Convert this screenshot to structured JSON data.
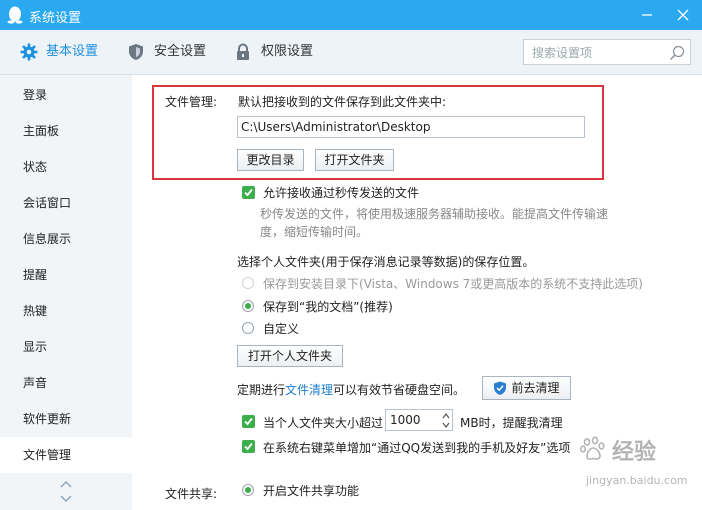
{
  "window": {
    "title": "系统设置"
  },
  "toolbar": {
    "tabs": [
      {
        "label": "基本设置",
        "active": true,
        "icon": "gear-icon"
      },
      {
        "label": "安全设置",
        "active": false,
        "icon": "shield-icon"
      },
      {
        "label": "权限设置",
        "active": false,
        "icon": "lock-icon"
      }
    ],
    "search_placeholder": "搜索设置项"
  },
  "sidebar": {
    "items": [
      "登录",
      "主面板",
      "状态",
      "会话窗口",
      "信息展示",
      "提醒",
      "热键",
      "显示",
      "声音",
      "软件更新",
      "文件管理"
    ],
    "active": "文件管理"
  },
  "file_management": {
    "section_label": "文件管理:",
    "default_save_desc": "默认把接收到的文件保存到此文件夹中:",
    "save_path": "C:\\Users\\Administrator\\Desktop",
    "change_dir_button": "更改目录",
    "open_folder_button": "打开文件夹",
    "allow_flash_transfer_label": "允许接收通过秒传发送的文件",
    "flash_transfer_desc_line1": "秒传发送的文件，将使用极速服务器辅助接收。能提高文件传输速",
    "flash_transfer_desc_line2": "度，缩短传输时间。",
    "personal_folder_desc": "选择个人文件夹(用于保存消息记录等数据)的保存位置。",
    "radio_install_dir": "保存到安装目录下(Vista、Windows 7或更高版本的系统不支持此选项)",
    "radio_my_documents": "保存到“我的文档”(推荐)",
    "radio_custom": "自定义",
    "open_personal_folder_button": "打开个人文件夹",
    "cleanup_prefix": "定期进行",
    "cleanup_link": "文件清理",
    "cleanup_suffix": "可以有效节省硬盘空间。",
    "go_cleanup_button": "前去清理",
    "size_limit_prefix": "当个人文件夹大小超过",
    "size_limit_value": "1000",
    "size_limit_suffix": "MB时，提醒我清理",
    "context_menu_label": "在系统右键菜单增加“通过QQ发送到我的手机及好友”选项"
  },
  "file_sharing": {
    "section_label": "文件共享:",
    "enable_sharing_label": "开启文件共享功能"
  },
  "watermark": {
    "text_cn": "经验",
    "text_en": "jingyan.baidu.com"
  },
  "colors": {
    "titlebar": "#2aa8f0",
    "accent": "#1e90e0",
    "checkbox": "#3cae4c",
    "highlight_box": "#d9363e"
  }
}
